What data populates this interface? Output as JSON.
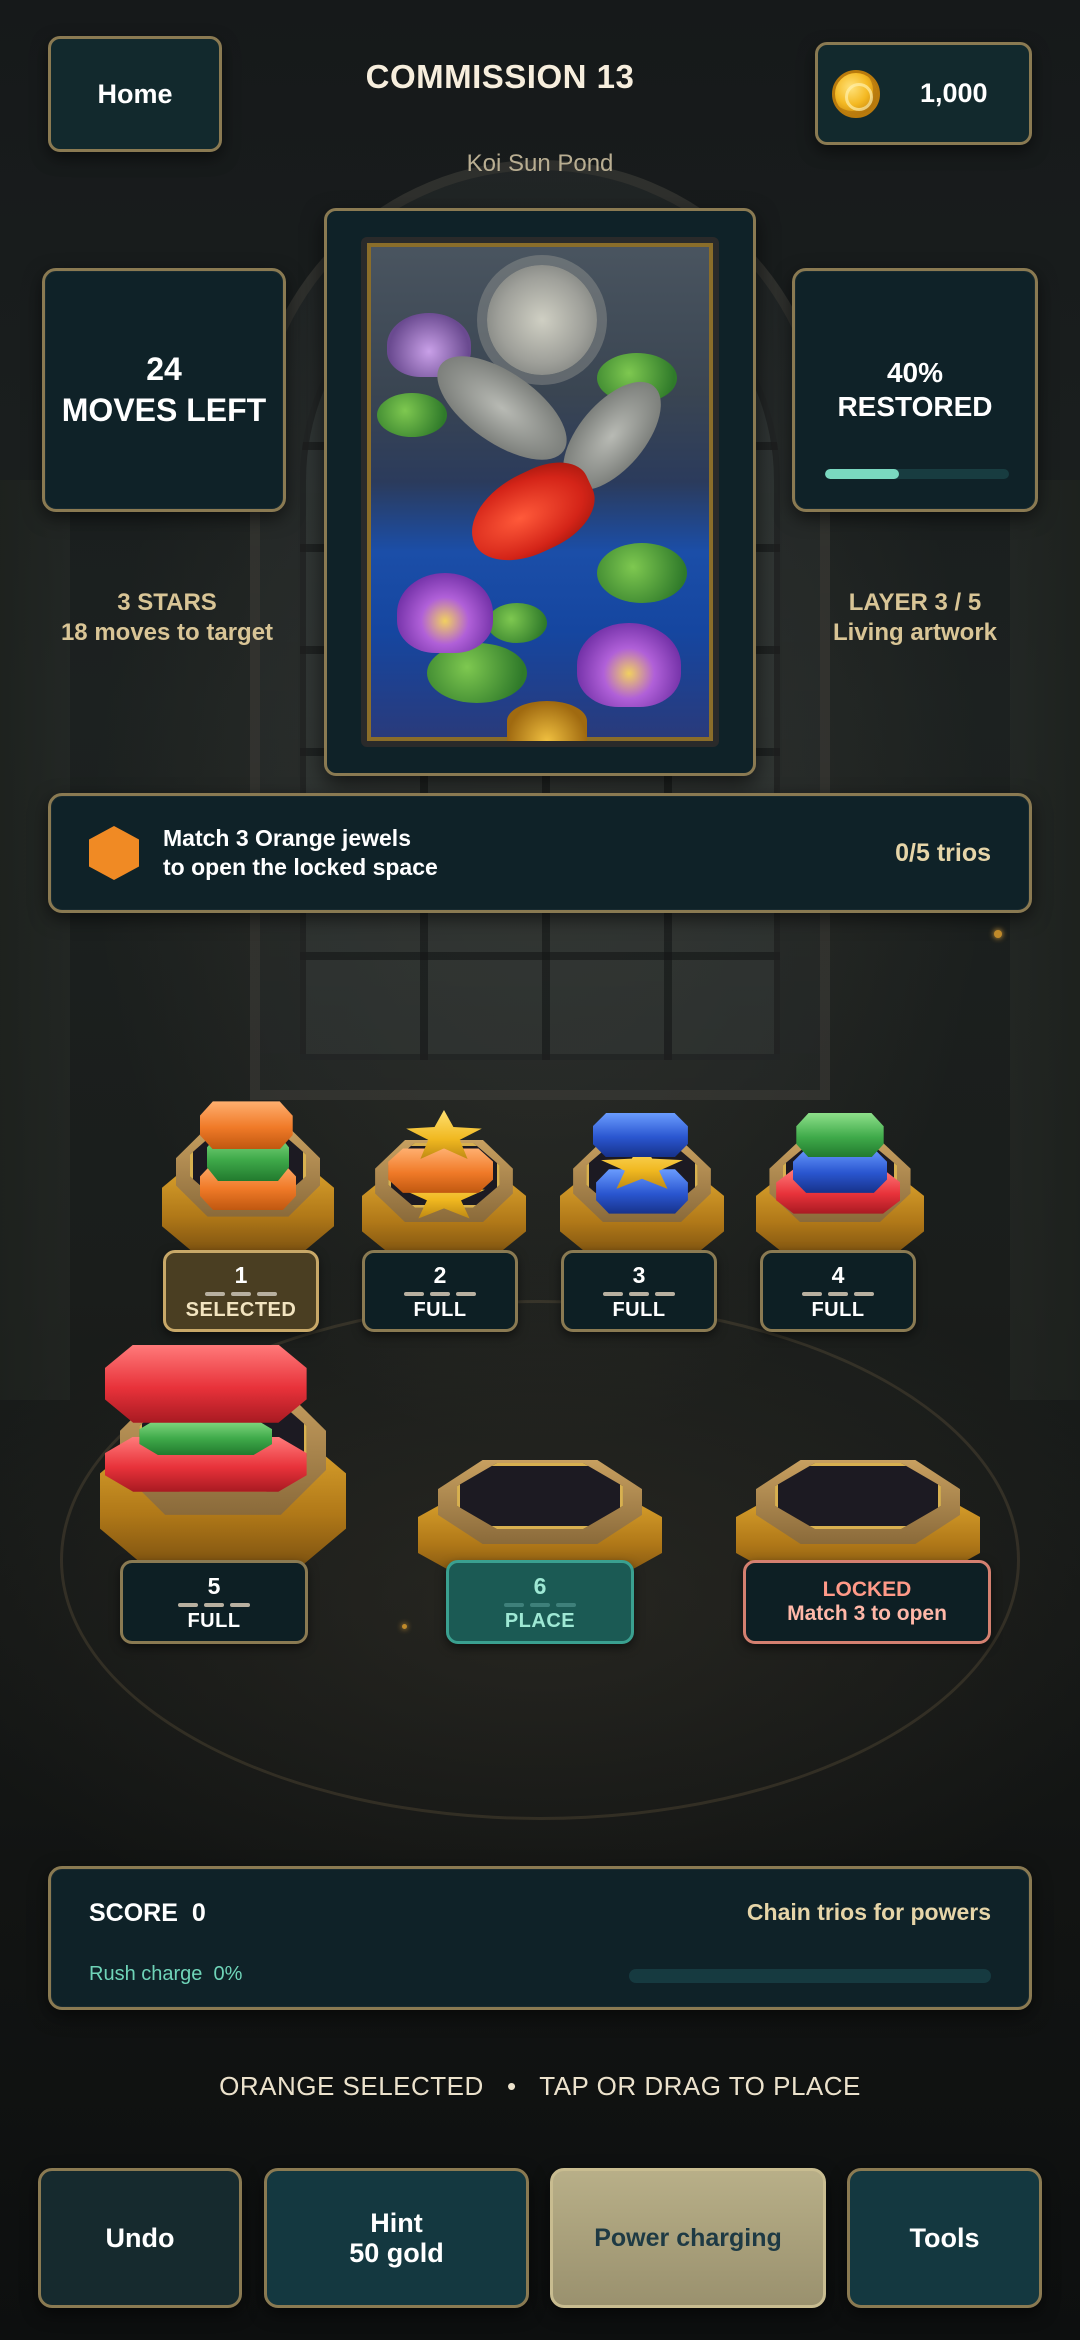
{
  "header": {
    "home_label": "Home",
    "title": "COMMISSION 13",
    "coins": "1,000",
    "coin_icon": "gold-coin-icon",
    "subtitle": "Koi Sun Pond"
  },
  "moves": {
    "count": "24",
    "label": "MOVES LEFT"
  },
  "restore": {
    "percent_text": "40%",
    "label": "RESTORED",
    "progress": 0.4
  },
  "stars": {
    "line1": "3 STARS",
    "line2": "18 moves to target"
  },
  "layer": {
    "line1": "LAYER 3 / 5",
    "line2": "Living artwork"
  },
  "goal": {
    "icon": "orange-hexagon-icon",
    "line1": "Match 3 Orange jewels",
    "line2": "to open the locked space",
    "progress": "0/5 trios"
  },
  "pedestals": [
    {
      "number": "1",
      "status": "SELECTED",
      "stack": [
        "orange",
        "green",
        "orange"
      ]
    },
    {
      "number": "2",
      "status": "FULL",
      "stack": [
        "yellow",
        "orange",
        "yellow"
      ]
    },
    {
      "number": "3",
      "status": "FULL",
      "stack": [
        "blue",
        "yellow",
        "blue"
      ]
    },
    {
      "number": "4",
      "status": "FULL",
      "stack": [
        "red",
        "blue",
        "green"
      ]
    },
    {
      "number": "5",
      "status": "FULL",
      "stack": [
        "red",
        "green",
        "red"
      ]
    },
    {
      "number": "6",
      "status": "PLACE",
      "stack": []
    },
    {
      "number": "",
      "status": "LOCKED",
      "sub": "Match 3 to open",
      "stack": []
    }
  ],
  "score": {
    "label": "SCORE",
    "value": "0",
    "hint": "Chain trios for powers",
    "rush_label": "Rush charge",
    "rush_value": "0%",
    "rush_progress": 0
  },
  "instruction": {
    "left": "ORANGE SELECTED",
    "separator": "•",
    "right": "TAP OR DRAG TO PLACE"
  },
  "actions": {
    "undo": "Undo",
    "hint_line1": "Hint",
    "hint_line2": "50 gold",
    "power": "Power charging",
    "tools": "Tools"
  },
  "colors": {
    "panel": "#0f2228",
    "border": "#8a7a52",
    "accent_teal": "#6fd4b8",
    "gold_text": "#d9c596",
    "orange": "#f08a24",
    "locked": "#d48070"
  }
}
